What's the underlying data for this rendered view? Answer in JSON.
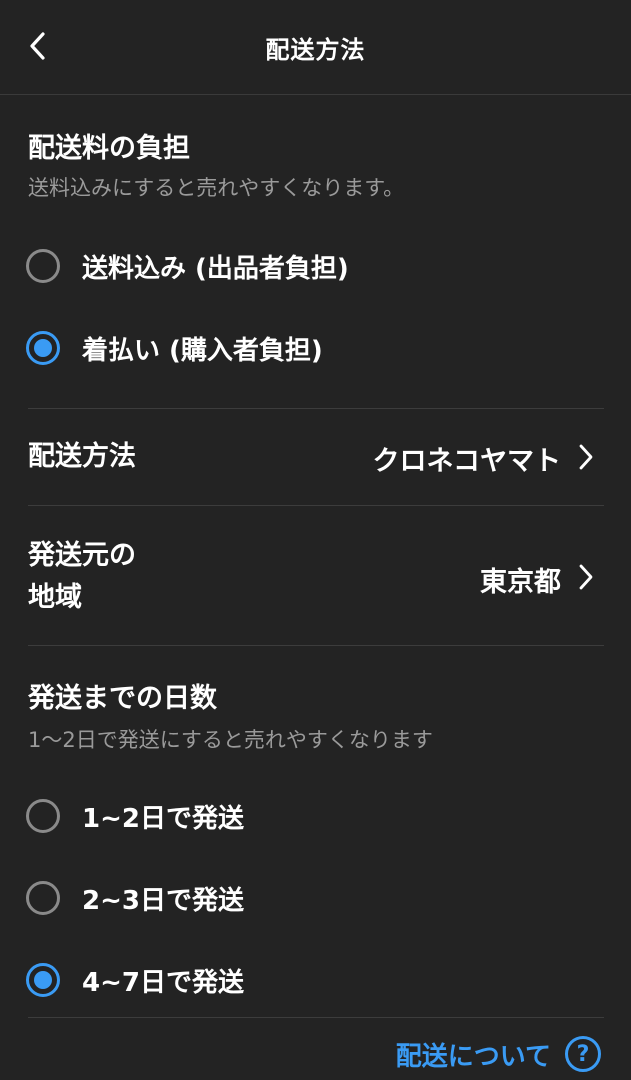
{
  "header": {
    "title": "配送方法",
    "back_icon": "chevron-left-icon"
  },
  "fee_section": {
    "title": "配送料の負担",
    "hint": "送料込みにすると売れやすくなります。",
    "options": [
      {
        "label": "送料込み (出品者負担)",
        "selected": false
      },
      {
        "label": "着払い (購入者負担)",
        "selected": true
      }
    ]
  },
  "shipping_method": {
    "label": "配送方法",
    "value": "クロネコヤマト"
  },
  "origin": {
    "label_line1": "発送元の",
    "label_line2": "地域",
    "value": "東京都"
  },
  "days_section": {
    "title": "発送までの日数",
    "hint": "1〜2日で発送にすると売れやすくなります",
    "options": [
      {
        "label": "1~2日で発送",
        "selected": false
      },
      {
        "label": "2~3日で発送",
        "selected": false
      },
      {
        "label": "4~7日で発送",
        "selected": true
      }
    ]
  },
  "footer": {
    "link_text": "配送について",
    "help_symbol": "?"
  },
  "colors": {
    "background": "#232323",
    "accent": "#3a9bf4",
    "hint": "#9a9a9a"
  }
}
